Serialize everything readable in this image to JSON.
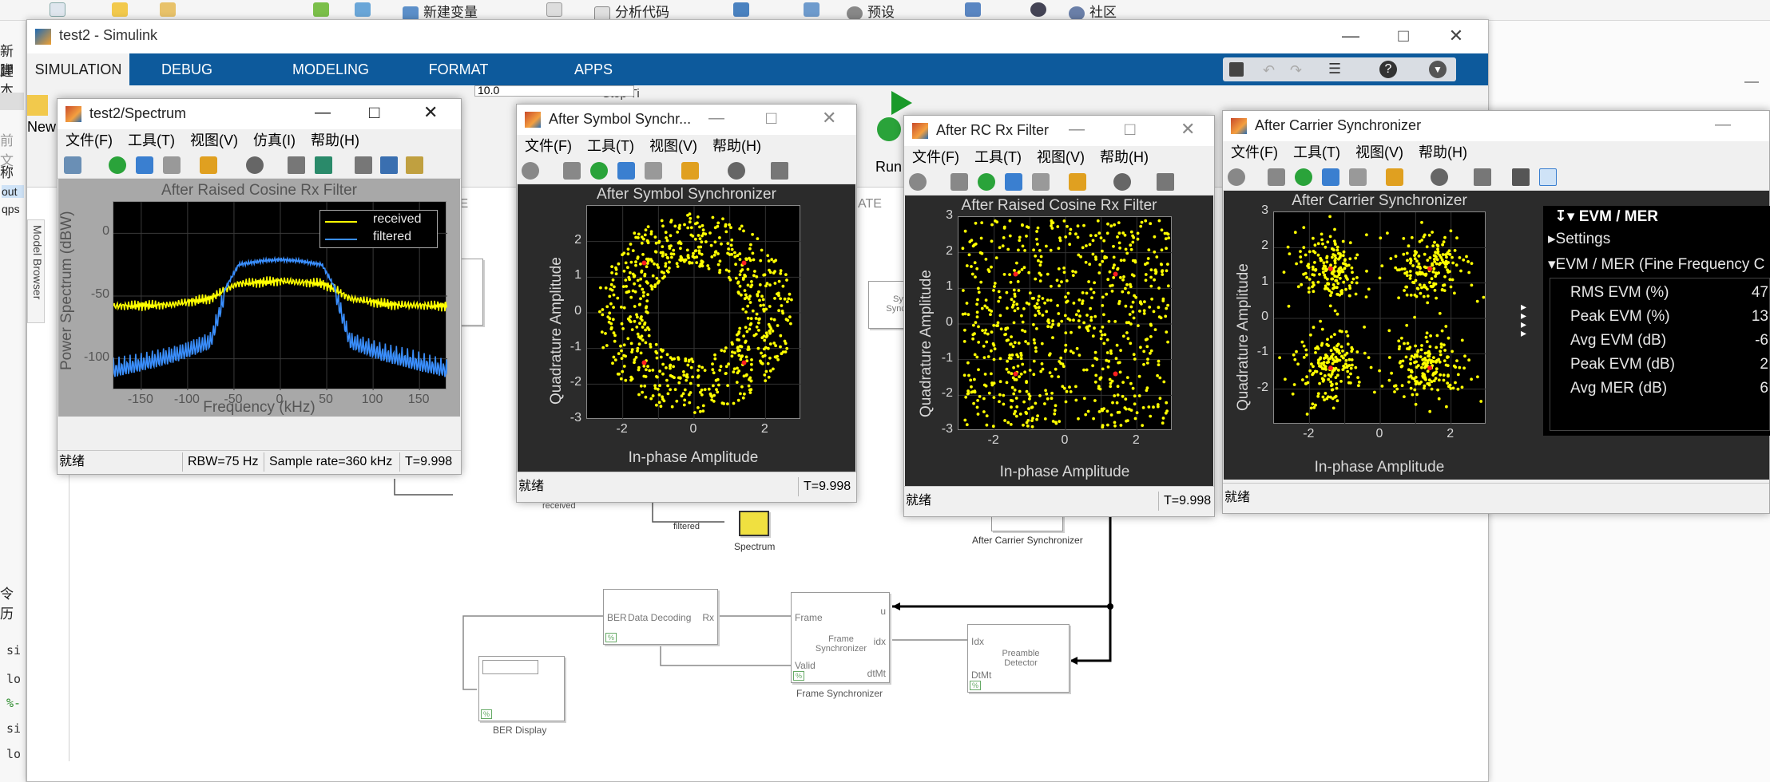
{
  "matlab_toolbar": [
    "新建变量",
    "分析代码",
    "预设",
    "社区"
  ],
  "matlab_left": [
    "新建",
    "脚本",
    "前文",
    "称",
    "out",
    "qps",
    "令历",
    "si",
    "lo",
    "%-",
    "si",
    "lo"
  ],
  "simulink": {
    "title": "test2 - Simulink",
    "tabs": [
      "SIMULATION",
      "DEBUG",
      "MODELING",
      "FORMAT",
      "APPS"
    ],
    "ribbon_labels": {
      "new": "New",
      "run": "Run",
      "stop_time_label": "Stop Ti",
      "stop_time_value": "10.0",
      "re_label": "RE",
      "ate_label": "ATE",
      "model_browser": "Model Browser"
    },
    "blocks": {
      "spectrum_label": "Spectrum",
      "after_carrier_label": "After Carrier Synchronizer",
      "data_decoding": "Data Decoding",
      "frame_sync": "Frame Synchronizer",
      "frame_sync_label": "Frame Synchronizer",
      "preamble": "Preamble Detector",
      "ber_display_label": "BER Display",
      "symbol_sync_partial": "Sym Synch",
      "received_label": "received",
      "filtered_label": "filtered",
      "port_ber": "BER",
      "port_rx": "Rx",
      "port_frame": "Frame",
      "port_u": "u",
      "port_idx": "idx",
      "port_idx2": "Idx",
      "port_valid": "Valid",
      "port_dtmt": "dtMt",
      "port_dtmt2": "DtMt",
      "c_partial": "c"
    }
  },
  "menus": {
    "file": "文件(F)",
    "tools": "工具(T)",
    "view": "视图(V)",
    "sim": "仿真(I)",
    "help": "帮助(H)"
  },
  "status_ready": "就绪",
  "spectrum_window": {
    "title": "test2/Spectrum",
    "plot_title": "After Raised Cosine Rx Filter",
    "ylabel": "Power Spectrum (dBW)",
    "xlabel": "Frequency (kHz)",
    "legend": [
      "received",
      "filtered"
    ],
    "rbw": "RBW=75 Hz",
    "sample_rate": "Sample rate=360 kHz",
    "time": "T=9.998"
  },
  "symbol_window": {
    "title": "After Symbol Synchr...",
    "plot_title": "After Symbol Synchronizer",
    "time": "T=9.998"
  },
  "rc_window": {
    "title": "After RC Rx Filter",
    "plot_title": "After Raised Cosine Rx Filter",
    "time": "T=9.998"
  },
  "carrier_window": {
    "title": "After Carrier Synchronizer",
    "plot_title": "After Carrier Synchronizer"
  },
  "const_axes": {
    "xlabel": "In-phase Amplitude",
    "ylabel": "Quadrature Amplitude"
  },
  "evm_panel": {
    "header": "EVM / MER",
    "settings": "Settings",
    "section": "EVM / MER (Fine Frequency C",
    "rows": [
      {
        "label": "RMS EVM (%)",
        "value": "47"
      },
      {
        "label": "Peak EVM (%)",
        "value": "13"
      },
      {
        "label": "Avg EVM (dB)",
        "value": "-6"
      },
      {
        "label": "Peak EVM (dB)",
        "value": "2"
      },
      {
        "label": "Avg MER (dB)",
        "value": "6"
      }
    ]
  },
  "chart_data": [
    {
      "type": "line",
      "title": "After Raised Cosine Rx Filter",
      "xlabel": "Frequency (kHz)",
      "ylabel": "Power Spectrum (dBW)",
      "xlim": [
        -180,
        180
      ],
      "ylim": [
        -125,
        25
      ],
      "xticks": [
        -150,
        -100,
        -50,
        0,
        50,
        100,
        150
      ],
      "yticks": [
        0,
        -50,
        -100
      ],
      "legend": "top-right",
      "series": [
        {
          "name": "received",
          "color": "#ffff00",
          "x": [
            -180,
            -120,
            -75,
            -60,
            -45,
            -20,
            0,
            20,
            45,
            60,
            75,
            120,
            180
          ],
          "values": [
            -58,
            -57,
            -52,
            -45,
            -40,
            -39,
            -38,
            -39,
            -40,
            -45,
            -52,
            -57,
            -58
          ]
        },
        {
          "name": "filtered",
          "color": "#3a8fff",
          "x": [
            -180,
            -150,
            -110,
            -75,
            -60,
            -45,
            -20,
            0,
            20,
            45,
            60,
            75,
            110,
            150,
            180
          ],
          "values": [
            -105,
            -100,
            -92,
            -82,
            -45,
            -25,
            -22,
            -21,
            -22,
            -25,
            -45,
            -82,
            -92,
            -100,
            -105
          ]
        }
      ]
    },
    {
      "type": "scatter",
      "title": "After Symbol Synchronizer",
      "xlabel": "In-phase Amplitude",
      "ylabel": "Quadrature Amplitude",
      "xlim": [
        -3,
        3
      ],
      "ylim": [
        -3,
        3
      ],
      "xticks": [
        -2,
        0,
        2
      ],
      "yticks": [
        -3,
        -2,
        -1,
        0,
        1,
        2
      ],
      "shape": "ring",
      "ideal_points": [
        [
          -1.4,
          1.4
        ],
        [
          1.4,
          1.4
        ],
        [
          -1.4,
          -1.4
        ],
        [
          1.4,
          -1.4
        ]
      ],
      "point_color": "#ffff00",
      "ideal_color": "#ff2020"
    },
    {
      "type": "scatter",
      "title": "After Raised Cosine Rx Filter",
      "xlabel": "In-phase Amplitude",
      "ylabel": "Quadrature Amplitude",
      "xlim": [
        -3,
        3
      ],
      "ylim": [
        -3,
        3
      ],
      "xticks": [
        -2,
        0,
        2
      ],
      "yticks": [
        -3,
        -2,
        -1,
        0,
        1,
        2,
        3
      ],
      "shape": "cloud",
      "ideal_points": [
        [
          -1.4,
          1.4
        ],
        [
          1.4,
          1.4
        ],
        [
          -1.4,
          -1.4
        ],
        [
          1.4,
          -1.4
        ]
      ],
      "point_color": "#ffff00",
      "ideal_color": "#ff2020"
    },
    {
      "type": "scatter",
      "title": "After Carrier Synchronizer",
      "xlabel": "In-phase Amplitude",
      "ylabel": "Quadrature Amplitude",
      "xlim": [
        -3,
        3
      ],
      "ylim": [
        -3,
        3
      ],
      "xticks": [
        -2,
        0,
        2
      ],
      "yticks": [
        -2,
        -1,
        0,
        1,
        2,
        3
      ],
      "shape": "clusters",
      "ideal_points": [
        [
          -1.4,
          1.4
        ],
        [
          1.4,
          1.4
        ],
        [
          -1.4,
          -1.4
        ],
        [
          1.4,
          -1.4
        ]
      ],
      "point_color": "#ffff00",
      "ideal_color": "#ff2020"
    }
  ]
}
